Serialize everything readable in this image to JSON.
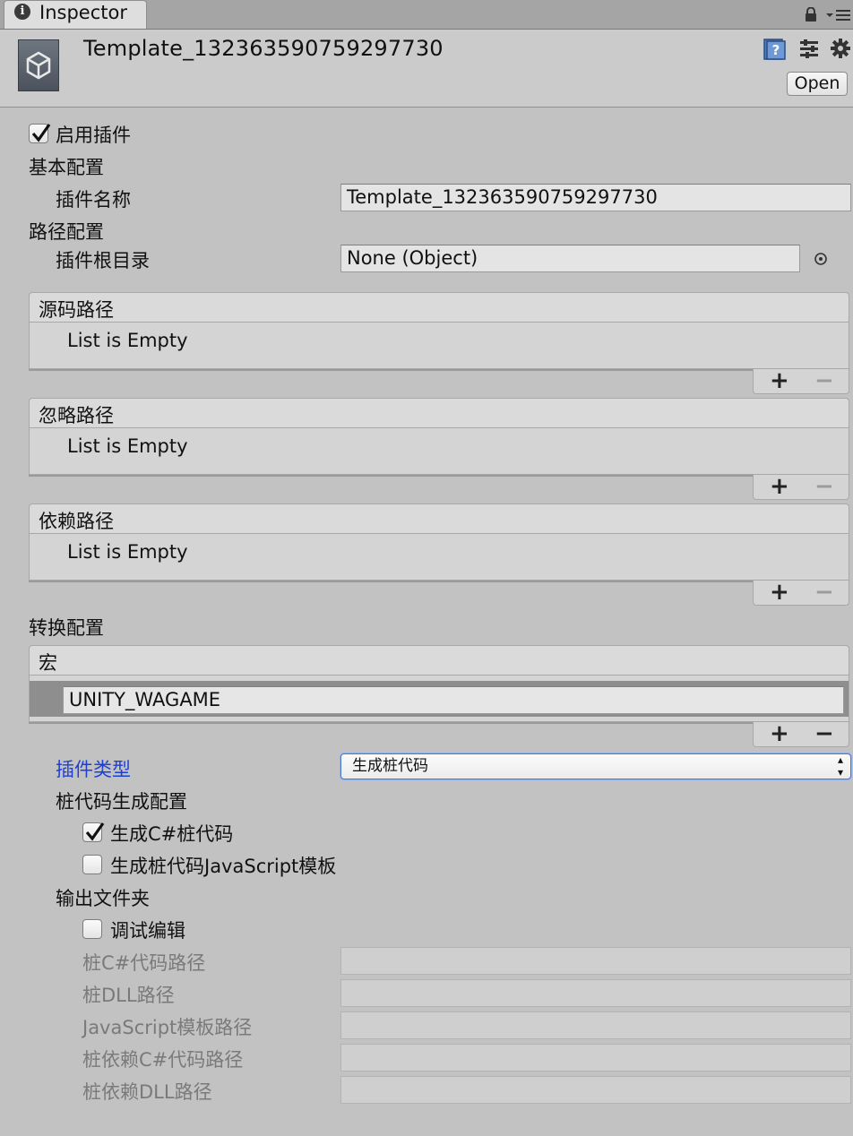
{
  "tab": {
    "label": "Inspector",
    "info_glyph": "i"
  },
  "header": {
    "title": "Template_132363590759297730",
    "open_label": "Open"
  },
  "enable_plugin": {
    "label": "启用插件",
    "checked": true
  },
  "basic": {
    "section_label": "基本配置",
    "plugin_name_label": "插件名称",
    "plugin_name_value": "Template_132363590759297730"
  },
  "path": {
    "section_label": "路径配置",
    "root_label": "插件根目录",
    "root_value": "None (Object)"
  },
  "lists": {
    "source": {
      "header": "源码路径",
      "empty": "List is Empty"
    },
    "ignore": {
      "header": "忽略路径",
      "empty": "List is Empty"
    },
    "dependency": {
      "header": "依赖路径",
      "empty": "List is Empty"
    },
    "add_glyph": "+",
    "remove_glyph": "−"
  },
  "convert": {
    "section_label": "转换配置",
    "macro_header": "宏",
    "macro_item": "UNITY_WAGAME"
  },
  "plugin_type": {
    "label": "插件类型",
    "value": "生成桩代码",
    "arrows": "▲\n▼"
  },
  "stub": {
    "section_label": "桩代码生成配置",
    "csharp_label": "生成C#桩代码",
    "csharp_checked": true,
    "js_label": "生成桩代码JavaScript模板",
    "js_checked": false
  },
  "output": {
    "section_label": "输出文件夹",
    "debug_label": "调试编辑",
    "debug_checked": false,
    "stub_cs_label": "桩C#代码路径",
    "stub_dll_label": "桩DLL路径",
    "js_template_label": "JavaScript模板路径",
    "dep_cs_label": "桩依赖C#代码路径",
    "dep_dll_label": "桩依赖DLL路径"
  }
}
